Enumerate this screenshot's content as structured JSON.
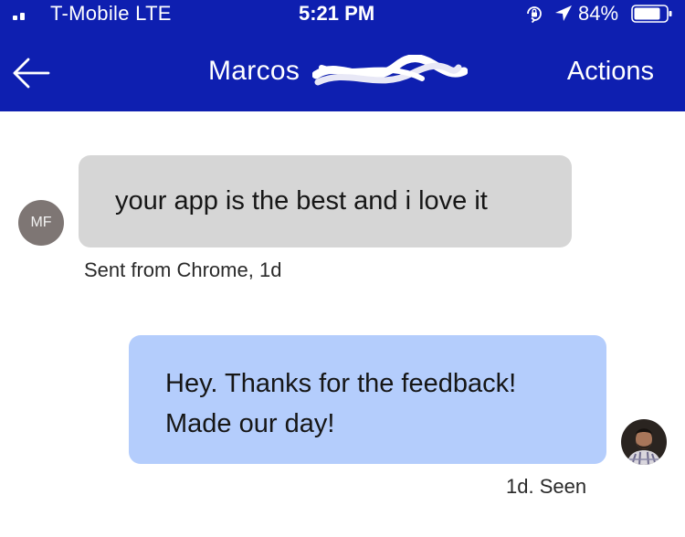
{
  "status_bar": {
    "carrier": "T-Mobile LTE",
    "time": "5:21 PM",
    "battery_percent": "84%",
    "icons": [
      "signal-icon",
      "orientation-lock-icon",
      "location-icon",
      "battery-icon"
    ]
  },
  "header": {
    "back_icon": "arrow-left-icon",
    "contact_name": "Marcos",
    "actions_label": "Actions",
    "background_color": "#0e1fb0"
  },
  "conversation": {
    "incoming": {
      "avatar_initials": "MF",
      "text": "your app is the best and i love it",
      "meta": "Sent from Chrome, 1d",
      "bubble_color": "#d6d6d6"
    },
    "outgoing": {
      "lines": [
        "Hey. Thanks for the feedback!",
        "Made our day!"
      ],
      "meta": "1d. Seen",
      "bubble_color": "#b4cdfc",
      "avatar": "user-photo-avatar"
    }
  }
}
